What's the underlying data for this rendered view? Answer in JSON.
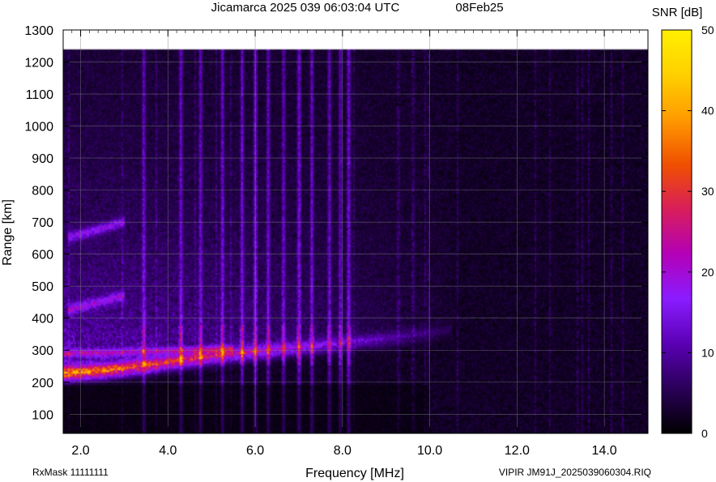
{
  "chart_data": {
    "type": "heatmap",
    "title": "Jicamarca 2025 039 06:03:04 UTC",
    "date_label": "08Feb25",
    "xlabel": "Frequency [MHz]",
    "ylabel": "Range [km]",
    "colorbar_label": "SNR [dB]",
    "xlim": [
      1.6,
      15.0
    ],
    "ylim": [
      40,
      1300
    ],
    "data_ylim": [
      40,
      1240
    ],
    "x_ticks": [
      2.0,
      4.0,
      6.0,
      8.0,
      10.0,
      12.0,
      14.0
    ],
    "x_tick_labels": [
      "2.0",
      "4.0",
      "6.0",
      "8.0",
      "10.0",
      "12.0",
      "14.0"
    ],
    "y_ticks": [
      100,
      200,
      300,
      400,
      500,
      600,
      700,
      800,
      900,
      1000,
      1100,
      1200,
      1300
    ],
    "y_tick_labels": [
      "100",
      "200",
      "300",
      "400",
      "500",
      "600",
      "700",
      "800",
      "900",
      "1000",
      "1100",
      "1200",
      "1300"
    ],
    "colorbar_ticks": [
      0,
      10,
      20,
      30,
      40,
      50
    ],
    "colorbar_tick_labels": [
      "0",
      "10",
      "20",
      "30",
      "40",
      "50"
    ],
    "colorbar_range": [
      0,
      50
    ],
    "colormap": [
      "#000000",
      "#2a0058",
      "#5a00b4",
      "#8a1cff",
      "#b400b8",
      "#d81e5a",
      "#f05000",
      "#ff9a00",
      "#ffd000",
      "#fff000"
    ],
    "grid": true,
    "footer_left": "RxMask 11111111",
    "footer_right": "VIPIR  JM91J_2025039060304.RIQ",
    "features": {
      "o_trace": [
        [
          1.7,
          225
        ],
        [
          2.5,
          232
        ],
        [
          3.5,
          248
        ],
        [
          4.5,
          268
        ],
        [
          5.5,
          285
        ],
        [
          6.5,
          298
        ],
        [
          7.5,
          310
        ],
        [
          8.5,
          325
        ],
        [
          9.5,
          340
        ],
        [
          10.5,
          358
        ]
      ],
      "x_trace": [
        [
          1.7,
          290
        ],
        [
          2.5,
          292
        ],
        [
          3.5,
          296
        ],
        [
          4.5,
          300
        ],
        [
          5.5,
          305
        ]
      ],
      "multi_hop_traces": [
        [
          [
            1.7,
            425
          ],
          [
            3.0,
            470
          ]
        ],
        [
          [
            1.7,
            650
          ],
          [
            3.0,
            700
          ]
        ]
      ],
      "vertical_interference_mhz": [
        3.45,
        4.3,
        4.75,
        5.25,
        5.7,
        6.0,
        6.3,
        6.65,
        7.0,
        7.3,
        7.7,
        7.95,
        8.15
      ],
      "peak_snr_db": 38
    }
  }
}
